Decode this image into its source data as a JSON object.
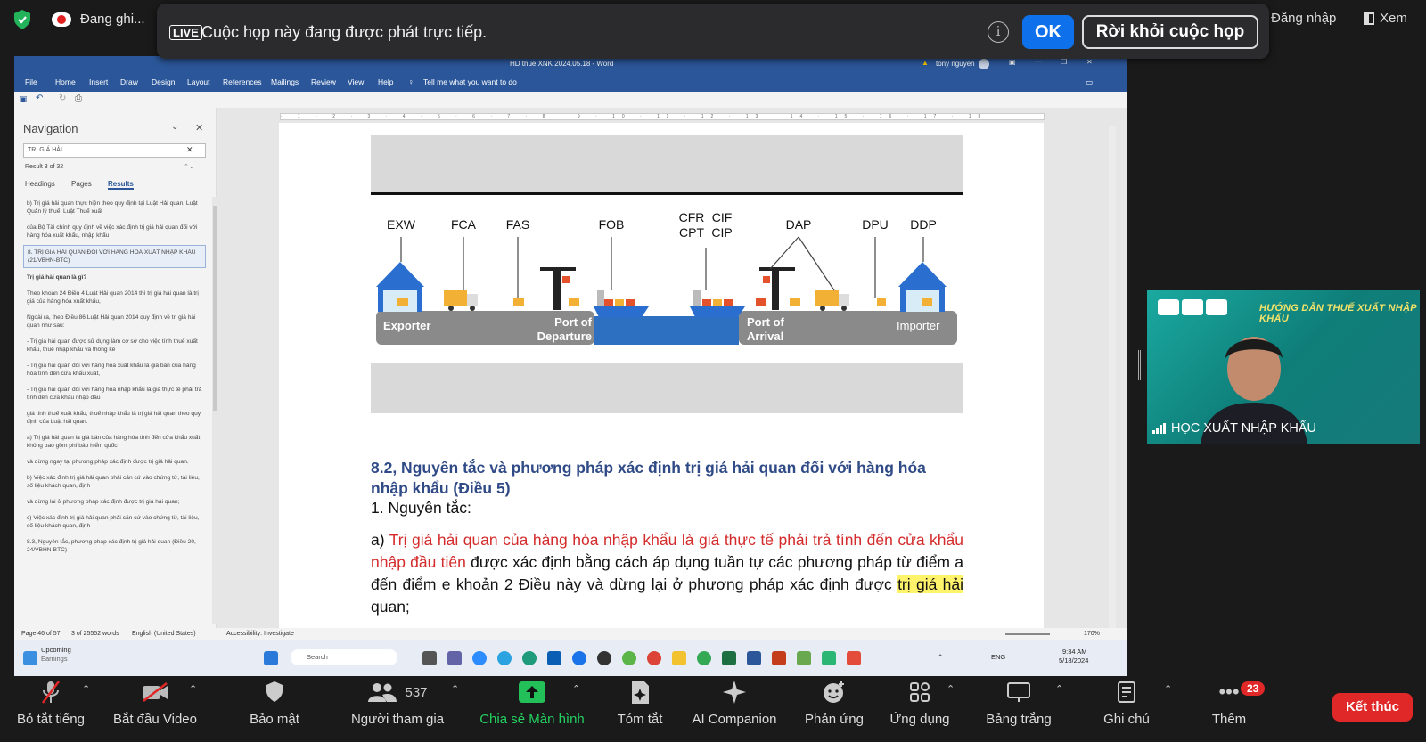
{
  "topbar": {
    "recording_label": "Đang ghi...",
    "live_badge": "LIVE",
    "live_message": "Cuộc họp này đang được phát trực tiếp.",
    "ok_label": "OK",
    "leave_label": "Rời khỏi cuộc họp",
    "signin_label": "Đăng nhập",
    "view_label": "Xem"
  },
  "word": {
    "window_title": "HD thue XNK 2024.05.18 - Word",
    "user_name": "tony nguyen",
    "ribbon_tabs": [
      "File",
      "Home",
      "Insert",
      "Draw",
      "Design",
      "Layout",
      "References",
      "Mailings",
      "Review",
      "View",
      "Help"
    ],
    "tell_me": "Tell me what you want to do",
    "navigation": {
      "title": "Navigation",
      "search_value": "TRỊ GIÁ HẢI",
      "result_count": "Result 3 of 32",
      "tabs": [
        "Headings",
        "Pages",
        "Results"
      ],
      "active_tab": "Results",
      "results": [
        "b) Trị giá hải quan thực hiện theo quy định tại Luật Hải quan, Luật Quản lý thuế, Luật Thuế xuất",
        "của Bộ Tài chính quy định về việc xác định trị giá hải quan đối với hàng hóa xuất khẩu, nhập khẩu",
        "8. TRỊ GIÁ HẢI QUAN ĐỐI VỚI HÀNG HOÁ XUẤT NHẬP KHẨU (21/VBHN-BTC)",
        "Trị giá hải quan là gì?",
        "Theo khoản 24 Điều 4 Luật Hải quan 2014 thì trị giá hải quan là trị giá của hàng hóa xuất khẩu,",
        "Ngoài ra, theo Điều 86 Luật Hải quan 2014 quy định về trị giá hải quan như sau:",
        "- Trị giá hải quan được sử dụng làm cơ sở cho việc tính thuế xuất khẩu, thuế nhập khẩu và thống kê",
        "- Trị giá hải quan đối với hàng hóa xuất khẩu là giá bán của hàng hóa tính đến cửa khẩu xuất,",
        "- Trị giá hải quan đối với hàng hóa nhập khẩu là giá thực tế phải trả tính đến cửa khẩu nhập đầu",
        "giá tính thuế xuất khẩu, thuế nhập khẩu là trị giá hải quan theo quy định của Luật hải quan.",
        "a) Trị giá hải quan là giá bán của hàng hóa tính đến cửa khẩu xuất không bao gồm phí bảo hiểm quốc",
        "và dừng ngay tại phương pháp xác định được trị giá hải quan.",
        "b) Việc xác định trị giá hải quan phải căn cứ vào chứng từ, tài liệu, số liệu khách quan, định",
        "và dừng lại ở phương pháp xác định được trị giá hải quan;",
        "c) Việc xác định trị giá hải quan phải căn cứ vào chứng từ, tài liệu, số liệu khách quan, định",
        "8.3, Nguyên tắc, phương pháp xác định trị giá hải quan (Điều 20, 24/VBHN-BTC)"
      ],
      "selected_index": 2
    },
    "diagram": {
      "terms_top": [
        "EXW",
        "FCA",
        "FAS",
        "FOB",
        "CFR",
        "CIF",
        "CPT",
        "CIP",
        "DAP",
        "DPU",
        "DDP"
      ],
      "labels": [
        "Exporter",
        "Port of Departure",
        "Port of Arrival",
        "Importer"
      ]
    },
    "doc": {
      "heading": "8.2, Nguyên tắc và phương pháp xác định trị giá hải quan đối với hàng hóa nhập khẩu (Điều 5)",
      "subheading": "1. Nguyên tắc:",
      "para_prefix": "a) ",
      "para_red": "Trị giá hải quan của hàng hóa nhập khẩu là giá thực tế phải trả tính đến cửa khẩu nhập đầu tiên",
      "para_mid": " được xác định bằng cách áp dụng tuần tự các phương pháp từ điểm a đến điểm e khoản 2 Điều này và dừng lại ở phương pháp xác định được ",
      "para_highlight": "trị giá hải",
      "para_end": " quan;"
    },
    "status": {
      "page": "Page 46 of 57",
      "words": "3 of 25552 words",
      "language": "English (United States)",
      "accessibility": "Accessibility: Investigate",
      "zoom": "170%"
    },
    "taskbar": {
      "upcoming": "Upcoming",
      "earnings": "Earnings",
      "search": "Search",
      "lang": "ENG",
      "time": "9:34 AM",
      "date": "5/18/2024"
    }
  },
  "video": {
    "banner": "HƯỚNG DẪN THUẾ XUẤT NHẬP KHẨU",
    "participant_name": "HỌC XUẤT NHẬP KHẨU"
  },
  "toolbar": {
    "mute": "Bỏ tắt tiếng",
    "video": "Bắt đầu Video",
    "security": "Bảo mật",
    "participants": "Người tham gia",
    "participants_count": "537",
    "share": "Chia sẻ Màn hình",
    "summary": "Tóm tắt",
    "ai": "AI Companion",
    "reactions": "Phản ứng",
    "apps": "Ứng dụng",
    "whiteboard": "Bảng trắng",
    "notes": "Ghi chú",
    "more": "Thêm",
    "more_badge": "23",
    "end": "Kết thúc"
  }
}
